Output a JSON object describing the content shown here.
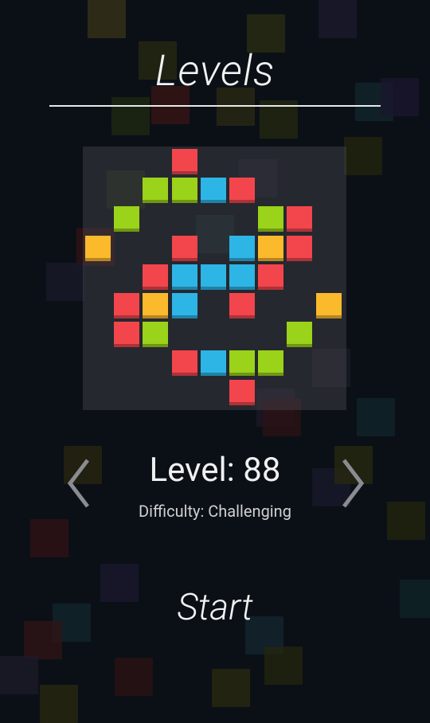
{
  "header": {
    "title": "Levels"
  },
  "level": {
    "label": "Level: 88",
    "difficulty": "Difficulty: Challenging"
  },
  "actions": {
    "start_label": "Start"
  },
  "colors": {
    "red": "#f2464c",
    "green": "#9bd21a",
    "blue": "#2db5e6",
    "yellow": "#fbb92c",
    "background": "#0b1017"
  },
  "board": {
    "grid_size": 9,
    "cells": [
      {
        "row": 0,
        "col": 3,
        "color": "red"
      },
      {
        "row": 1,
        "col": 2,
        "color": "green"
      },
      {
        "row": 1,
        "col": 3,
        "color": "green"
      },
      {
        "row": 1,
        "col": 4,
        "color": "blue"
      },
      {
        "row": 1,
        "col": 5,
        "color": "red"
      },
      {
        "row": 2,
        "col": 1,
        "color": "green"
      },
      {
        "row": 2,
        "col": 6,
        "color": "green"
      },
      {
        "row": 2,
        "col": 7,
        "color": "red"
      },
      {
        "row": 3,
        "col": 0,
        "color": "yellow"
      },
      {
        "row": 3,
        "col": 3,
        "color": "red"
      },
      {
        "row": 3,
        "col": 5,
        "color": "blue"
      },
      {
        "row": 3,
        "col": 6,
        "color": "yellow"
      },
      {
        "row": 3,
        "col": 7,
        "color": "red"
      },
      {
        "row": 4,
        "col": 2,
        "color": "red"
      },
      {
        "row": 4,
        "col": 3,
        "color": "blue"
      },
      {
        "row": 4,
        "col": 4,
        "color": "blue"
      },
      {
        "row": 4,
        "col": 5,
        "color": "blue"
      },
      {
        "row": 4,
        "col": 6,
        "color": "red"
      },
      {
        "row": 5,
        "col": 1,
        "color": "red"
      },
      {
        "row": 5,
        "col": 2,
        "color": "yellow"
      },
      {
        "row": 5,
        "col": 3,
        "color": "blue"
      },
      {
        "row": 5,
        "col": 5,
        "color": "red"
      },
      {
        "row": 5,
        "col": 8,
        "color": "yellow"
      },
      {
        "row": 6,
        "col": 1,
        "color": "red"
      },
      {
        "row": 6,
        "col": 2,
        "color": "green"
      },
      {
        "row": 6,
        "col": 7,
        "color": "green"
      },
      {
        "row": 7,
        "col": 3,
        "color": "red"
      },
      {
        "row": 7,
        "col": 4,
        "color": "blue"
      },
      {
        "row": 7,
        "col": 5,
        "color": "green"
      },
      {
        "row": 7,
        "col": 6,
        "color": "green"
      },
      {
        "row": 8,
        "col": 5,
        "color": "red"
      }
    ]
  }
}
